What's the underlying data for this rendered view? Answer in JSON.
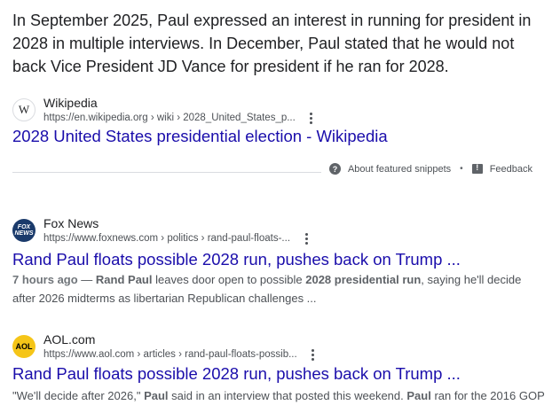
{
  "snippet": {
    "text": "In September 2025, Paul expressed an interest in running for president in 2028 in multiple interviews. In December, Paul stated that he would not back Vice President JD Vance for president if he ran for 2028."
  },
  "featured_source": {
    "favicon_text": "W",
    "name": "Wikipedia",
    "url": "https://en.wikipedia.org › wiki › 2028_United_States_p...",
    "title": "2028 United States presidential election - Wikipedia"
  },
  "feedback": {
    "about_label": "About featured snippets",
    "separator": "•",
    "feedback_label": "Feedback"
  },
  "results": [
    {
      "favicon_text": "FOX NEWS",
      "name": "Fox News",
      "url": "https://www.foxnews.com › politics › rand-paul-floats-...",
      "title": "Rand Paul floats possible 2028 run, pushes back on Trump ...",
      "time": "7 hours ago",
      "dash": " — ",
      "desc_parts": [
        "Rand Paul",
        " leaves door open to possible ",
        "2028 presidential run",
        ", saying he'll decide after 2026 midterms as libertarian Republican challenges ..."
      ]
    },
    {
      "favicon_text": "AOL",
      "name": "AOL.com",
      "url": "https://www.aol.com › articles › rand-paul-floats-possib...",
      "title": "Rand Paul floats possible 2028 run, pushes back on Trump ...",
      "desc_parts": [
        "\"We'll decide after 2026,\" ",
        "Paul",
        " said in an interview that posted this weekend. ",
        "Paul",
        " ran for the 2016 GOP"
      ]
    }
  ]
}
